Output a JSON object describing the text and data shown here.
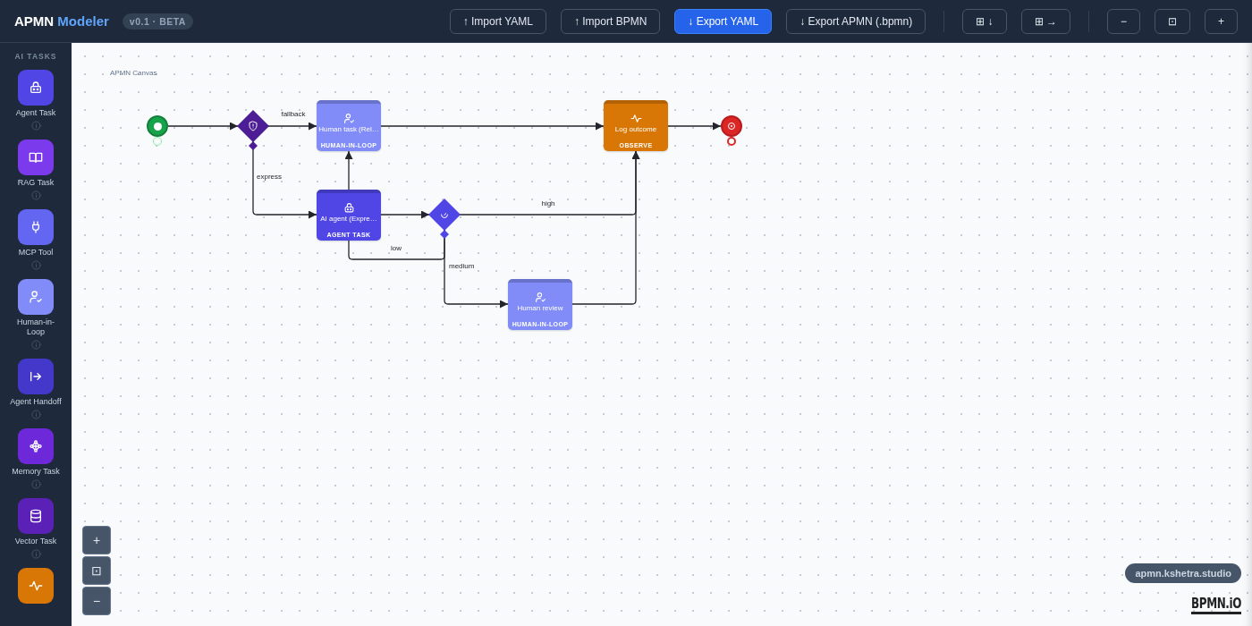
{
  "header": {
    "brand": "APMN",
    "brand_accent": "Modeler",
    "badge": "v0.1 · BETA",
    "toolbar_groups": [
      [
        {
          "label": "↑ Import YAML",
          "primary": false
        },
        {
          "label": "↑ Import BPMN",
          "primary": false
        },
        {
          "label": "↓ Export YAML",
          "primary": true
        },
        {
          "label": "↓ Export APMN (.bpmn)",
          "primary": false
        }
      ],
      [
        {
          "label": "⊞ ↓",
          "primary": false
        },
        {
          "label": "⊞ →",
          "primary": false
        }
      ],
      [
        {
          "label": "−",
          "primary": false
        },
        {
          "label": "⊡",
          "primary": false
        },
        {
          "label": "+",
          "primary": false
        }
      ]
    ]
  },
  "sidebar": {
    "section": "AI TASKS",
    "items": [
      {
        "label": "Agent Task",
        "color": "#4f46e5"
      },
      {
        "label": "RAG Task",
        "color": "#7c3aed"
      },
      {
        "label": "MCP Tool",
        "color": "#6366f1"
      },
      {
        "label": "Human-in-Loop",
        "color": "#818cf8"
      },
      {
        "label": "Agent Handoff",
        "color": "#4338ca"
      },
      {
        "label": "Memory Task",
        "color": "#6d28d9"
      },
      {
        "label": "Vector Task",
        "color": "#5b21b6"
      },
      {
        "color": "#d97706"
      }
    ]
  },
  "canvas": {
    "title": "APMN Canvas",
    "nodes": [
      {
        "kind": "start"
      },
      {
        "kind": "gateway",
        "color": "#4c1d95"
      },
      {
        "kind": "task",
        "label": "Human task (Rel…",
        "type": "HUMAN-IN-LOOP",
        "color": "#818cf8"
      },
      {
        "kind": "task",
        "label": "Log outcome",
        "type": "OBSERVE",
        "color": "#d97706"
      },
      {
        "kind": "end"
      },
      {
        "kind": "task",
        "label": "AI agent (Expre…",
        "type": "AGENT TASK",
        "color": "#4f46e5"
      },
      {
        "kind": "gateway",
        "color": "#4f46e5"
      },
      {
        "kind": "task",
        "label": "Human review",
        "type": "HUMAN-IN-LOOP",
        "color": "#818cf8"
      }
    ],
    "edge_labels": [
      "fallback",
      "express",
      "high",
      "low",
      "medium"
    ],
    "zoom_controls": [
      "+",
      "⊡",
      "−"
    ],
    "site": "apmn.kshetra.studio",
    "logo": "BPMN.iO"
  }
}
